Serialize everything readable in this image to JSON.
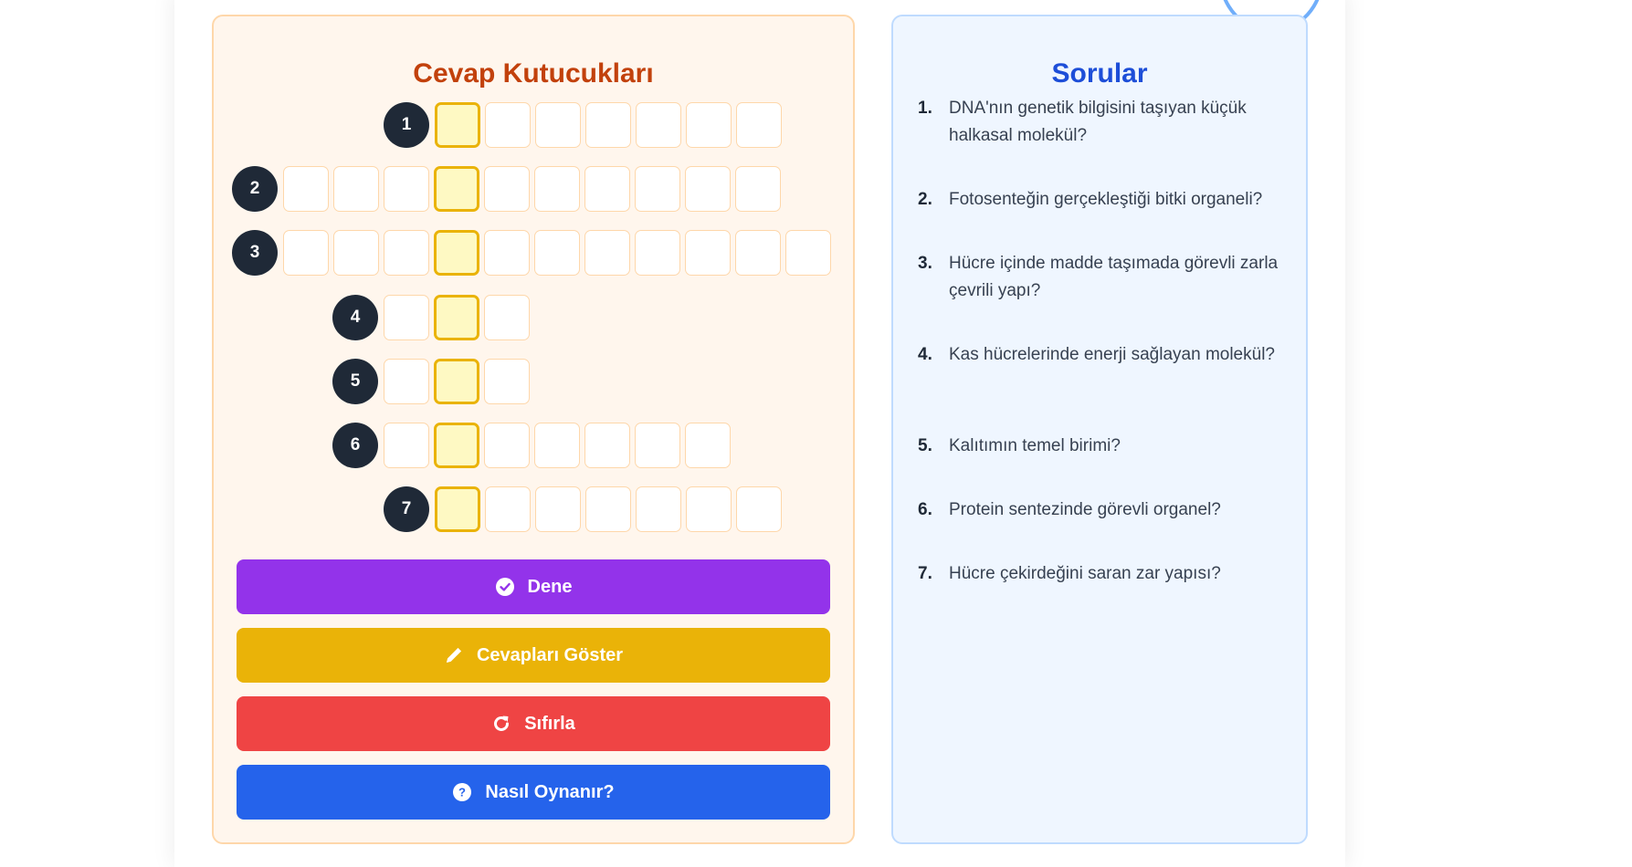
{
  "answers_panel": {
    "title": "Cevap Kutucukları",
    "rows": [
      {
        "number": "1"
      },
      {
        "number": "2"
      },
      {
        "number": "3"
      },
      {
        "number": "4"
      },
      {
        "number": "5"
      },
      {
        "number": "6"
      },
      {
        "number": "7"
      }
    ]
  },
  "buttons": {
    "try": "Dene",
    "show_answers": "Cevapları Göster",
    "reset": "Sıfırla",
    "how_to_play": "Nasıl Oynanır?"
  },
  "questions_panel": {
    "title": "Sorular",
    "items": [
      {
        "num": "1.",
        "text": "DNA'nın genetik bilgisini taşıyan küçük halkasal molekül?"
      },
      {
        "num": "2.",
        "text": "Fotosenteğin gerçekleştiği bitki organeli?"
      },
      {
        "num": "3.",
        "text": "Hücre içinde madde taşımada görevli zarla çevrili yapı?"
      },
      {
        "num": "4.",
        "text": "Kas hücrelerinde enerji sağlayan molekül?"
      },
      {
        "num": "5.",
        "text": "Kalıtımın temel birimi?"
      },
      {
        "num": "6.",
        "text": "Protein sentezinde görevli organel?"
      },
      {
        "num": "7.",
        "text": "Hücre çekirdeğini saran zar yapısı?"
      }
    ]
  },
  "colors": {
    "key_cell": "#fef9c3",
    "key_border": "#eab308",
    "btn_try": "#9333ea",
    "btn_show": "#eab308",
    "btn_reset": "#ef4444",
    "btn_help": "#2563eb"
  }
}
